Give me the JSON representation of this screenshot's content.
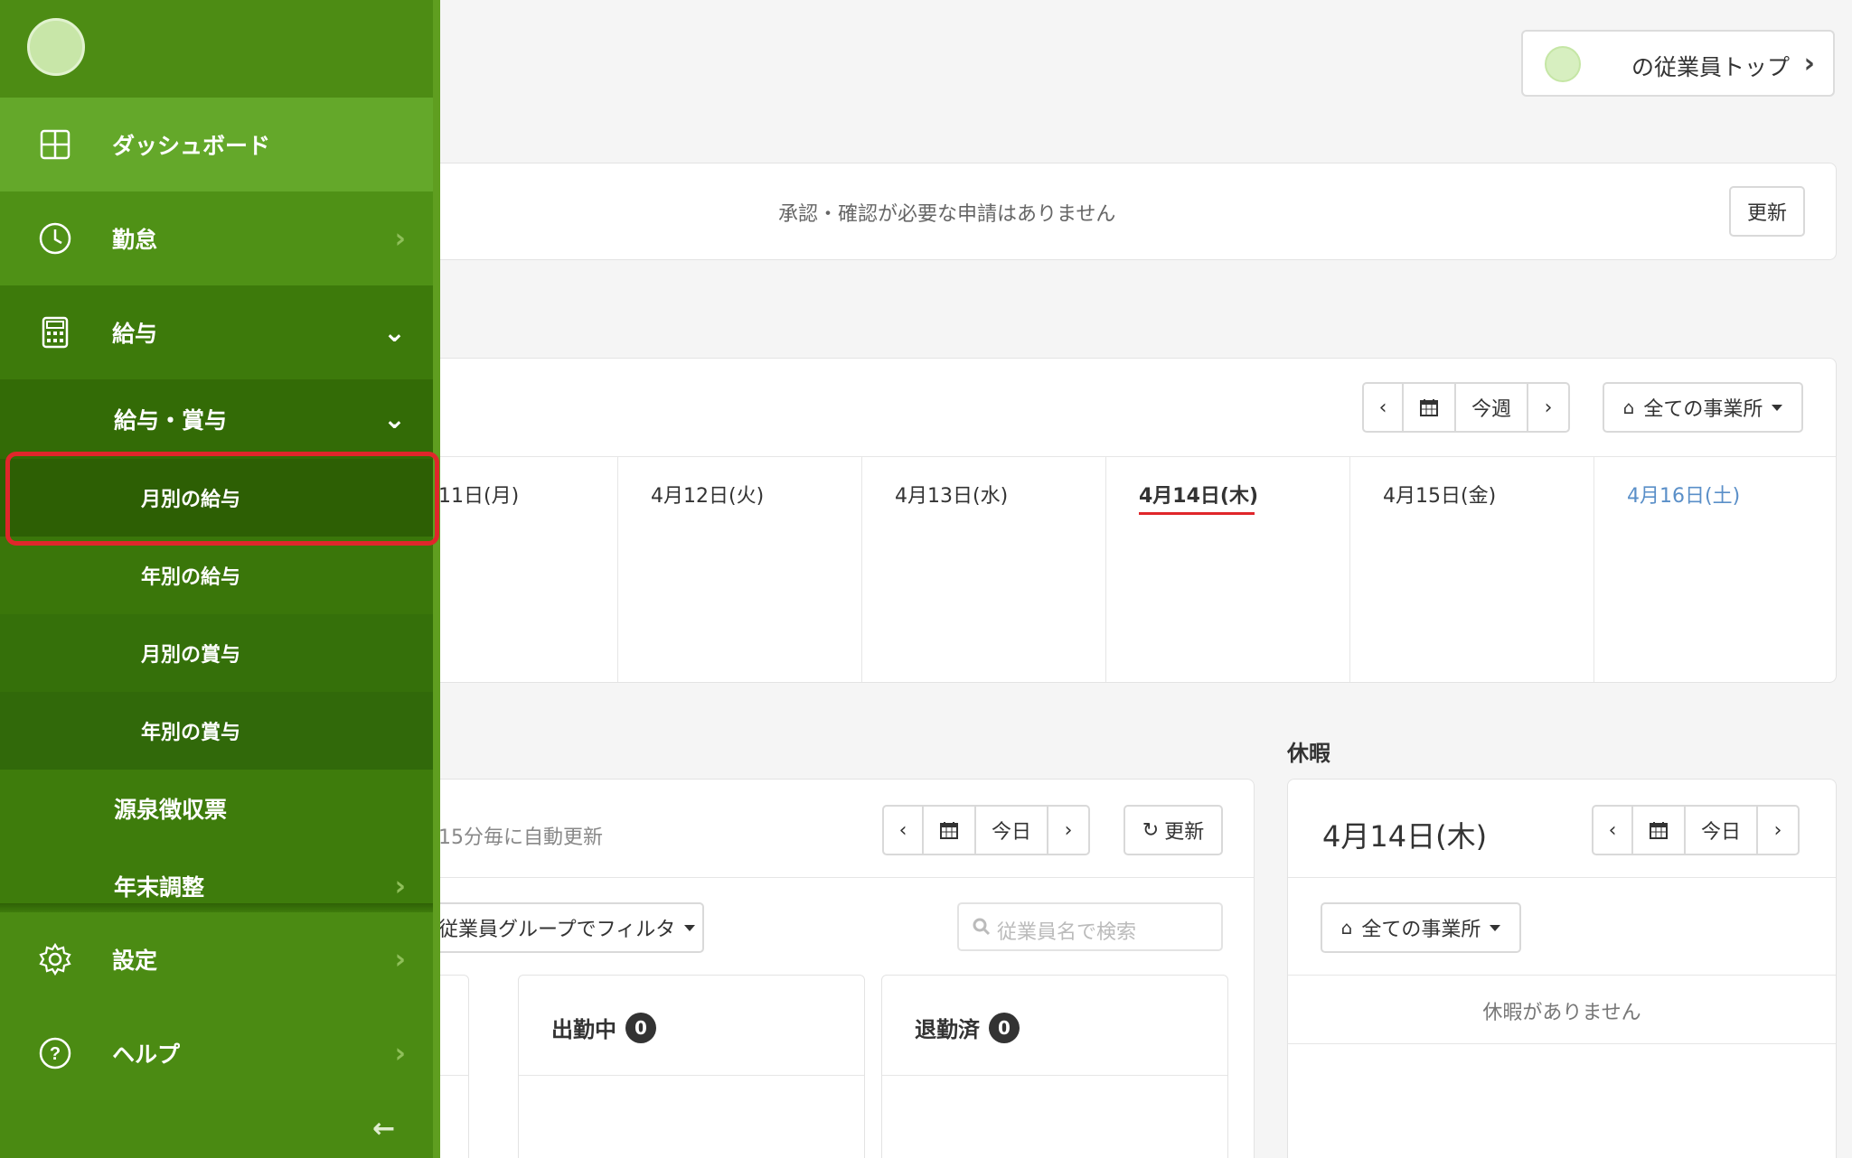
{
  "top": {
    "employee_top_label": "の従業員トップ"
  },
  "notice": {
    "text": "承認・確認が必要な申請はありません",
    "refresh_label": "更新"
  },
  "week": {
    "nav": {
      "today_label": "今週"
    },
    "office_filter": "全ての事業所",
    "days": [
      {
        "label": "11日(月)"
      },
      {
        "label": "4月12日(火)"
      },
      {
        "label": "4月13日(水)"
      },
      {
        "label": "4月14日(木)"
      },
      {
        "label": "4月15日(金)"
      },
      {
        "label": "4月16日(土)"
      }
    ]
  },
  "attendance": {
    "auto_refresh_text": "15分毎に自動更新",
    "today_label": "今日",
    "refresh_label": "更新",
    "group_filter": "従業員グループでフィルタ",
    "search_placeholder": "従業員名で検索",
    "working": {
      "label": "出勤中",
      "count": "0"
    },
    "left": {
      "label": "退勤済",
      "count": "0"
    }
  },
  "leave": {
    "section_title": "休暇",
    "date_month": "4",
    "date_day": "14",
    "date_label": "4月14日(木)",
    "today_label": "今日",
    "office_filter": "全ての事業所",
    "empty_text": "休暇がありません"
  },
  "sidebar": {
    "dashboard": "ダッシュボード",
    "kintai": "勤怠",
    "kyuyo": "給与",
    "kyuyo_shoyo": "給与・賞与",
    "monthly_salary": "月別の給与",
    "yearly_salary": "年別の給与",
    "monthly_bonus": "月別の賞与",
    "yearly_bonus": "年別の賞与",
    "gensen": "源泉徴収票",
    "nenmatsu": "年末調整",
    "settings": "設定",
    "help": "ヘルプ"
  },
  "colors": {
    "sidebar": "#4a8a12",
    "active": "#2d5f04",
    "highlight": "#e0262b",
    "today_underline": "#e0262b",
    "saturday": "#5a8fc8"
  }
}
